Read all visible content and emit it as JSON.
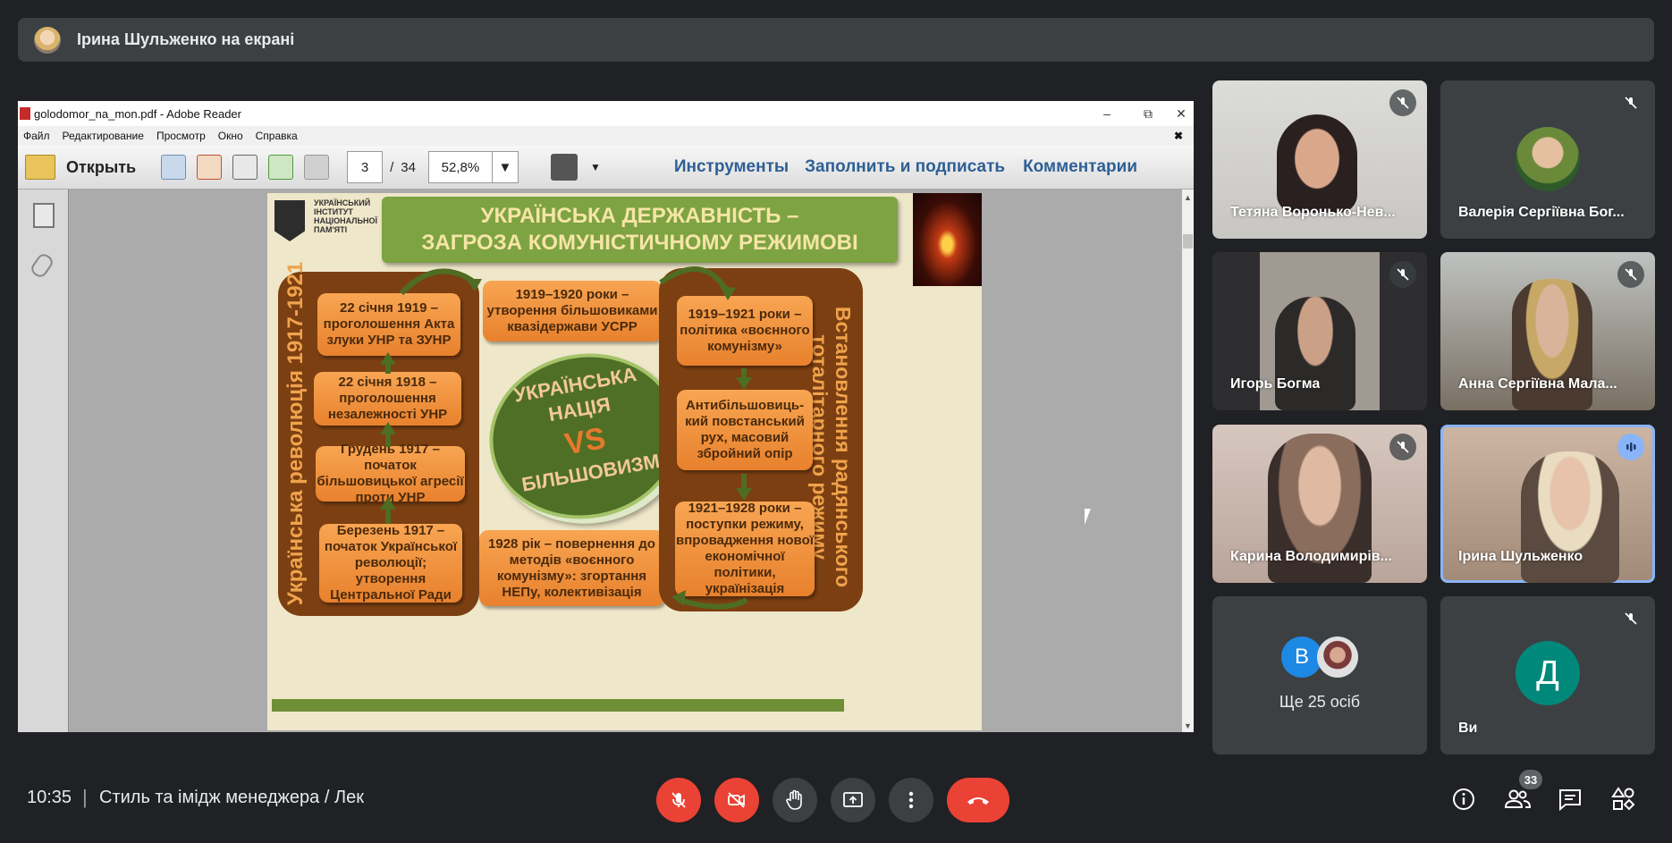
{
  "presenter_banner": {
    "text": "Ірина Шульженко на екрані"
  },
  "window": {
    "title": "golodomor_na_mon.pdf - Adobe Reader",
    "menu": [
      "Файл",
      "Редактирование",
      "Просмотр",
      "Окно",
      "Справка"
    ],
    "toolbar": {
      "open_label": "Открыть",
      "page_current": "3",
      "page_sep": "/",
      "page_total": "34",
      "zoom": "52,8%",
      "tools": "Инструменты",
      "fill_sign": "Заполнить и подписать",
      "comments": "Комментарии"
    }
  },
  "slide": {
    "logo_text": "УКРАЇНСЬКИЙ ІНСТИТУТ НАЦІОНАЛЬНОЇ ПАМ'ЯТІ",
    "title_line1": "УКРАЇНСЬКА ДЕРЖАВНІСТЬ –",
    "title_line2": "ЗАГРОЗА КОМУНІСТИЧНОМУ РЕЖИМОВІ",
    "left_vertical": "Українська революція 1917-1921",
    "right_vertical": "Встановлення радянського тоталітарного режиму",
    "left_boxes": [
      "22 січня 1919 – проголошення Акта злуки УНР та ЗУНР",
      "22 січня 1918 – проголошення незалежності УНР",
      "Грудень 1917 – початок більшовицької агресії проти УНР",
      "Березень 1917 – початок Української революції; утворення Центральної Ради"
    ],
    "center_top": "1919–1920 роки – утворення більшовиками квазідержави УСРР",
    "center_bottom": "1928 рік – повернення до методів «воєнного комунізму»: згортання НЕПу, колективізація",
    "right_boxes": [
      "1919–1921 роки – політика «воєнного комунізму»",
      "Антибільшовиць-кий повстанський рух, масовий збройний опір",
      "1921–1928 роки – поступки режиму, впровадження нової економічної політики, українізація"
    ],
    "oval_line1": "УКРАЇНСЬКА",
    "oval_line2": "НАЦІЯ",
    "oval_vs": "VS",
    "oval_line3": "БІЛЬШОВИЗМ"
  },
  "participants": [
    {
      "name": "Тетяна Воронько-Нев...",
      "muted": true
    },
    {
      "name": "Валерія Сергіївна Бог...",
      "muted": true
    },
    {
      "name": "Игорь Богма",
      "muted": true
    },
    {
      "name": "Анна Сергіївна Мала...",
      "muted": true
    },
    {
      "name": "Карина Володимирів...",
      "muted": true
    },
    {
      "name": "Ірина Шульженко",
      "muted": false,
      "speaking": true
    },
    {
      "name": "Ще 25 осіб",
      "avatar_letter": "В"
    },
    {
      "name": "Ви",
      "avatar_letter": "Д",
      "muted": true
    }
  ],
  "bottom": {
    "time": "10:35",
    "separator": "|",
    "meeting_title": "Стиль та імідж менеджера / Лек",
    "people_count": "33"
  },
  "colors": {
    "bg": "#202124",
    "red": "#ea4335",
    "speaking": "#8ab4f8",
    "avatar_d": "#00897b",
    "avatar_v": "#1e88e5"
  }
}
